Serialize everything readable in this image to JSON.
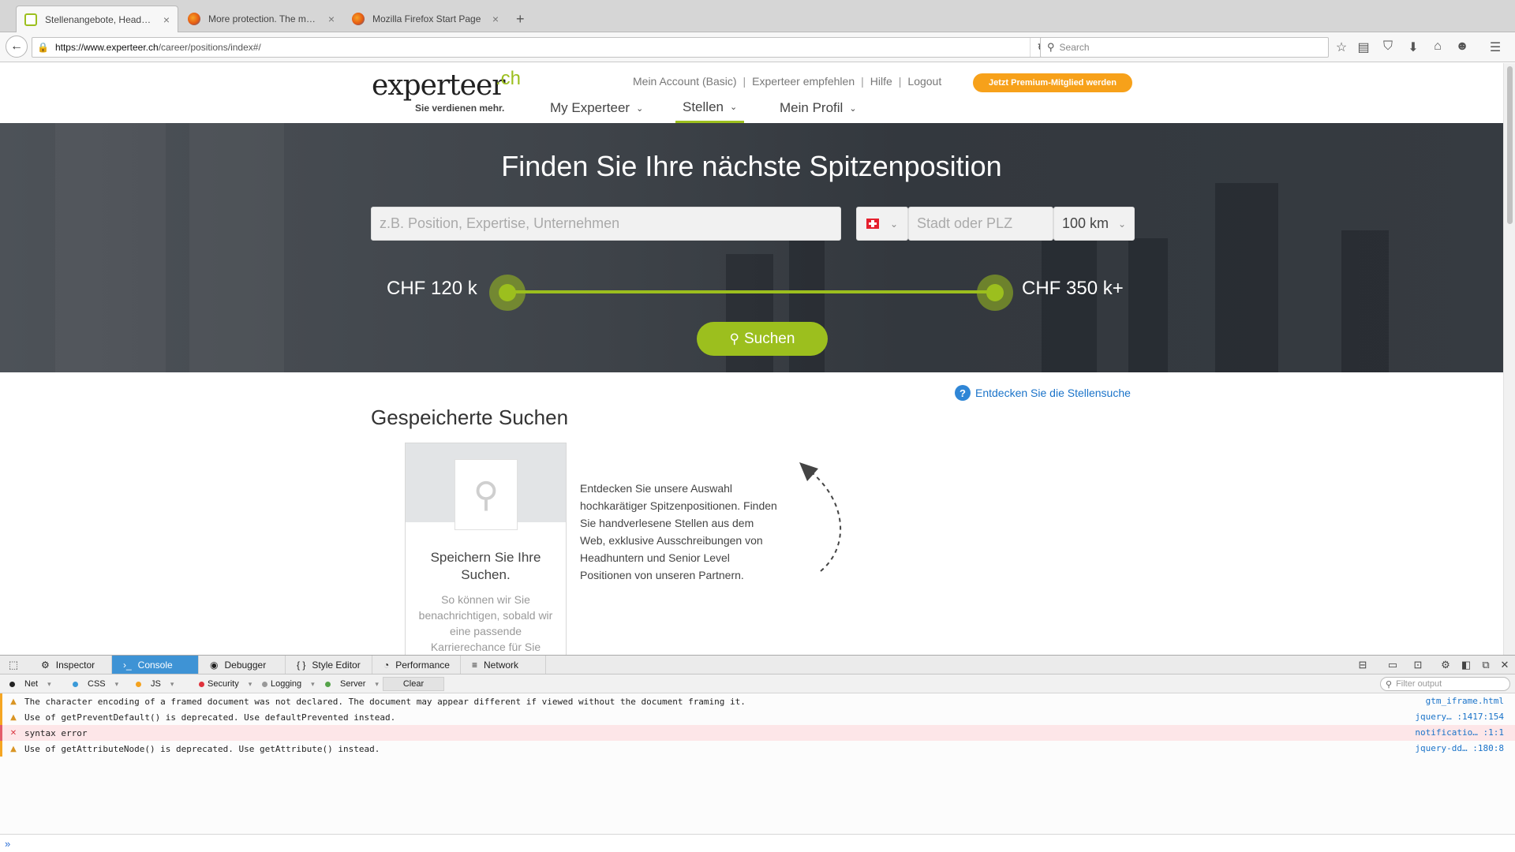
{
  "browser": {
    "tabs": [
      {
        "title": "Stellenangebote, Headhunt...",
        "active": true
      },
      {
        "title": "More protection. The most ...",
        "active": false
      },
      {
        "title": "Mozilla Firefox Start Page",
        "active": false
      }
    ],
    "tab_close": "×",
    "new_tab": "+",
    "url_host": "https://www.experteer.ch",
    "url_path": "/career/positions/index#/",
    "search_placeholder": "Search"
  },
  "site": {
    "logo_word": "experteer",
    "logo_tld": ".ch",
    "slogan": "Sie verdienen mehr.",
    "toplinks": [
      "Mein Account (Basic)",
      "Experteer empfehlen",
      "Hilfe",
      "Logout"
    ],
    "toplink_sep": "|",
    "premium_cta": "Jetzt Premium-Mitglied werden",
    "nav": [
      {
        "label": "My Experteer",
        "active": false
      },
      {
        "label": "Stellen",
        "active": true
      },
      {
        "label": "Mein Profil",
        "active": false
      }
    ]
  },
  "hero": {
    "title": "Finden Sie Ihre nächste Spitzenposition",
    "keyword_placeholder": "z.B. Position, Expertise, Unternehmen",
    "city_placeholder": "Stadt oder PLZ",
    "radius": "100 km",
    "salary_min": "CHF 120 k",
    "salary_max": "CHF 350 k+",
    "search_button": "Suchen"
  },
  "content": {
    "help_link": "Entdecken Sie die Stellensuche",
    "saved_title": "Gespeicherte Suchen",
    "card_heading": "Speichern Sie Ihre Suchen.",
    "card_text": "So können wir Sie benachrichtigen, sobald wir eine passende Karrierechance für Sie finden.",
    "intro": "Entdecken Sie unsere Auswahl hochkarätiger Spitzenpositionen. Finden Sie handverlesene Stellen aus dem Web, exklusive Ausschreibungen von Headhuntern und Senior Level Positionen von unseren Partnern."
  },
  "devtools": {
    "tabs": [
      "Inspector",
      "Console",
      "Debugger",
      "Style Editor",
      "Performance",
      "Network"
    ],
    "active_tab": "Console",
    "filters": [
      "Net",
      "CSS",
      "JS",
      "Security",
      "Logging",
      "Server"
    ],
    "clear": "Clear",
    "filter_placeholder": "Filter output",
    "logs": [
      {
        "level": "warn",
        "message": "The character encoding of a framed document was not declared. The document may appear different if viewed without the document framing it.",
        "source": "gtm_iframe.html"
      },
      {
        "level": "warn",
        "message": "Use of getPreventDefault() is deprecated.  Use defaultPrevented instead.",
        "source": "jquery… :1417:154"
      },
      {
        "level": "error",
        "message": "syntax error",
        "source": "notificatio… :1:1"
      },
      {
        "level": "warn",
        "message": "Use of getAttributeNode() is deprecated. Use getAttribute() instead.",
        "source": "jquery-dd… :180:8"
      }
    ],
    "prompt": "»"
  },
  "colors": {
    "accent": "#9cbf1e",
    "premium": "#f7a11a",
    "link": "#1a73c9",
    "devtools_active": "#3e93d5"
  }
}
